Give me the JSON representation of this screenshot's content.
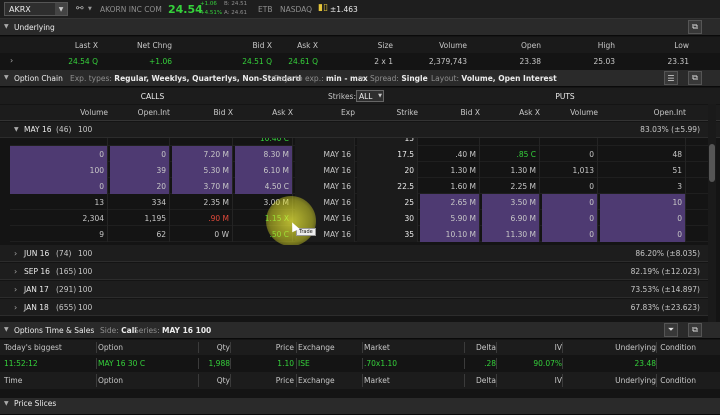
{
  "header": {
    "symbol": "AKRX",
    "company": "AKORN INC COM",
    "last": "24.54",
    "chg_top": "+1.06",
    "chg_pct": "+4.51%",
    "bid_small": "B: 24.51",
    "ask_small": "A: 24.61",
    "etb": "ETB",
    "exchange": "NASDAQ",
    "move": "±1.463"
  },
  "underlying": {
    "title": "Underlying",
    "headers": [
      "Last X",
      "Net Chng",
      "Bid X",
      "Ask X",
      "Size",
      "Volume",
      "Open",
      "High",
      "Low"
    ],
    "values": [
      "24.54 Q",
      "+1.06",
      "24.51 Q",
      "24.61 Q",
      "2 x 1",
      "2,379,743",
      "23.38",
      "25.03",
      "23.31"
    ]
  },
  "option_chain": {
    "title": "Option Chain",
    "exp_label": "Exp. types:",
    "exp_value": "Regular, Weeklys, Quarterlys, Non-Standard",
    "days_label": "Days to exp.:",
    "days_value": "min - max",
    "spread_label": "Spread:",
    "spread_value": "Single",
    "layout_label": "Layout:",
    "layout_value": "Volume, Open Interest",
    "calls": "CALLS",
    "puts": "PUTS",
    "strikes_label": "Strikes:",
    "strikes_value": "ALL",
    "columns": [
      "Volume",
      "Open.Int",
      "Bid X",
      "Ask X",
      "Exp",
      "Strike",
      "Bid X",
      "Ask X",
      "Volume",
      "Open.Int"
    ],
    "may_label": "MAY 16",
    "may_count": "(46)",
    "may_mult": "100",
    "may_iv": "83.03% (±5.99)",
    "partial_row": [
      "",
      "",
      "",
      "10.40 C",
      "",
      "15",
      "",
      "",
      "",
      ""
    ],
    "rows": [
      {
        "c": [
          "0",
          "0",
          "7.20 M",
          "8.30 M",
          "MAY 16",
          "17.5",
          ".40 M",
          ".85 C",
          "0",
          "48"
        ]
      },
      {
        "c": [
          "100",
          "39",
          "5.30 M",
          "6.10 M",
          "MAY 16",
          "20",
          "1.30 M",
          "1.30 M",
          "1,013",
          "51"
        ]
      },
      {
        "c": [
          "0",
          "20",
          "3.70 M",
          "4.50 C",
          "MAY 16",
          "22.5",
          "1.60 M",
          "2.25 M",
          "0",
          "3"
        ]
      },
      {
        "c": [
          "13",
          "334",
          "2.35 M",
          "3.00 M",
          "MAY 16",
          "25",
          "2.65 M",
          "3.50 M",
          "0",
          "10"
        ]
      },
      {
        "c": [
          "2,304",
          "1,195",
          ".90 M",
          "1.15 X",
          "MAY 16",
          "30",
          "5.90 M",
          "6.90 M",
          "0",
          "0"
        ]
      },
      {
        "c": [
          "9",
          "62",
          "0 W",
          ".50 C",
          "MAY 16",
          "35",
          "10.10 M",
          "11.30 M",
          "0",
          "0"
        ]
      }
    ],
    "tooltip": "Trade",
    "expirations": [
      {
        "label": "JUN 16",
        "count": "(74)",
        "mult": "100",
        "iv": "86.20% (±8.035)"
      },
      {
        "label": "SEP 16",
        "count": "(165)",
        "mult": "100",
        "iv": "82.19% (±12.023)"
      },
      {
        "label": "JAN 17",
        "count": "(291)",
        "mult": "100",
        "iv": "73.53% (±14.897)"
      },
      {
        "label": "JAN 18",
        "count": "(655)",
        "mult": "100",
        "iv": "67.83% (±23.623)"
      }
    ]
  },
  "time_sales": {
    "title": "Options Time & Sales",
    "side_label": "Side:",
    "side_value": "Call",
    "series_label": "Series:",
    "series_value": "MAY 16 100",
    "biggest_headers": [
      "Today's biggest",
      "Option",
      "Qty",
      "Price",
      "Exchange",
      "Market",
      "Delta",
      "IV",
      "Underlying",
      "Condition"
    ],
    "biggest_values": [
      "11:52:12",
      "MAY 16 30 C",
      "1,988",
      "1.10",
      "ISE",
      ".70x1.10",
      ".28",
      "90.07%",
      "23.48",
      ""
    ],
    "headers": [
      "Time",
      "Option",
      "Qty",
      "Price",
      "Exchange",
      "Market",
      "Delta",
      "IV",
      "Underlying",
      "Condition"
    ]
  },
  "footer": {
    "title": "Price Slices"
  },
  "colors": {
    "purple": "#4e3a72",
    "green": "#35d13b",
    "red": "#e24a3b",
    "highlight": "#e8e832"
  }
}
